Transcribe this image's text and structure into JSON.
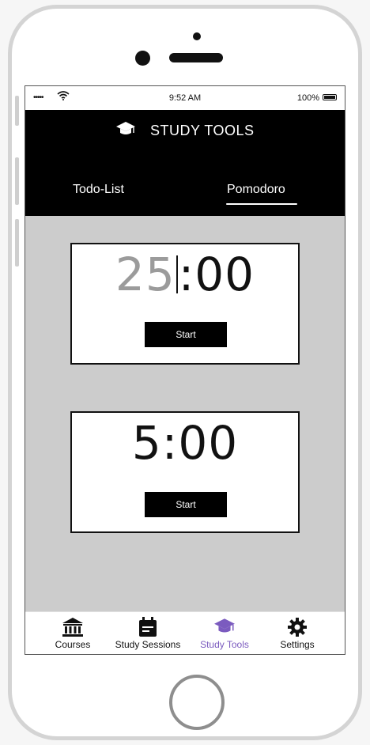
{
  "status_bar": {
    "signal": "•••••",
    "time": "9:52 AM",
    "battery": "100%"
  },
  "header": {
    "title": "STUDY TOOLS",
    "icon": "graduation-cap-icon"
  },
  "tabs": [
    {
      "label": "Todo-List",
      "active": false
    },
    {
      "label": "Pomodoro",
      "active": true
    }
  ],
  "timers": [
    {
      "minutes": "25",
      "rest": ":00",
      "start_label": "Start"
    },
    {
      "display": "5:00",
      "start_label": "Start"
    }
  ],
  "bottom_nav": [
    {
      "label": "Courses",
      "icon": "bank-icon",
      "active": false
    },
    {
      "label": "Study Sessions",
      "icon": "calendar-icon",
      "active": false
    },
    {
      "label": "Study Tools",
      "icon": "graduation-cap-icon",
      "active": true
    },
    {
      "label": "Settings",
      "icon": "gear-icon",
      "active": false
    }
  ],
  "colors": {
    "active_nav": "#7b5bbf",
    "header_bg": "#000000",
    "content_bg": "#cccccc"
  }
}
